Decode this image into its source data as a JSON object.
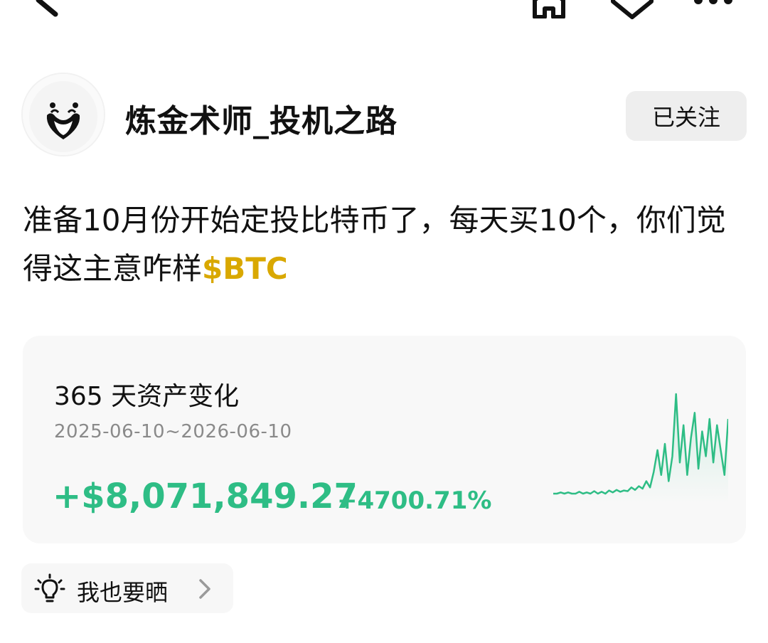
{
  "nav": {
    "icons": [
      "back-arrow-icon",
      "home-icon",
      "tag-icon",
      "more-icon"
    ]
  },
  "author": {
    "name": "炼金术师_投机之路",
    "follow_label": "已关注"
  },
  "post": {
    "text": "准备10月份开始定投比特币了，每天买10个，你们觉得这主意咋样",
    "ticker": "$BTC"
  },
  "pnl": {
    "title": "365 天资产变化",
    "date_range": "2025-06-10~2026-06-10",
    "amount": "+$8,071,849.27",
    "percent": "+4700.71%",
    "color": "#2ebd85"
  },
  "chart_data": {
    "type": "line",
    "series": [
      {
        "values": [
          0,
          0,
          0.2,
          0,
          0.2,
          0,
          0,
          0.3,
          0,
          0.2,
          0,
          0.4,
          0,
          0.3,
          0,
          0.5,
          0.2,
          0.6,
          0.3,
          0.5,
          0.4,
          1.0,
          0.6,
          1.2,
          0.8,
          2,
          1,
          3.5,
          7,
          3,
          8,
          2,
          6,
          16,
          5,
          11,
          3,
          9,
          13,
          4,
          10,
          6,
          12,
          5,
          11,
          7,
          3,
          12
        ]
      }
    ]
  },
  "share": {
    "label": "我也要晒",
    "icon": "lightbulb-icon"
  }
}
